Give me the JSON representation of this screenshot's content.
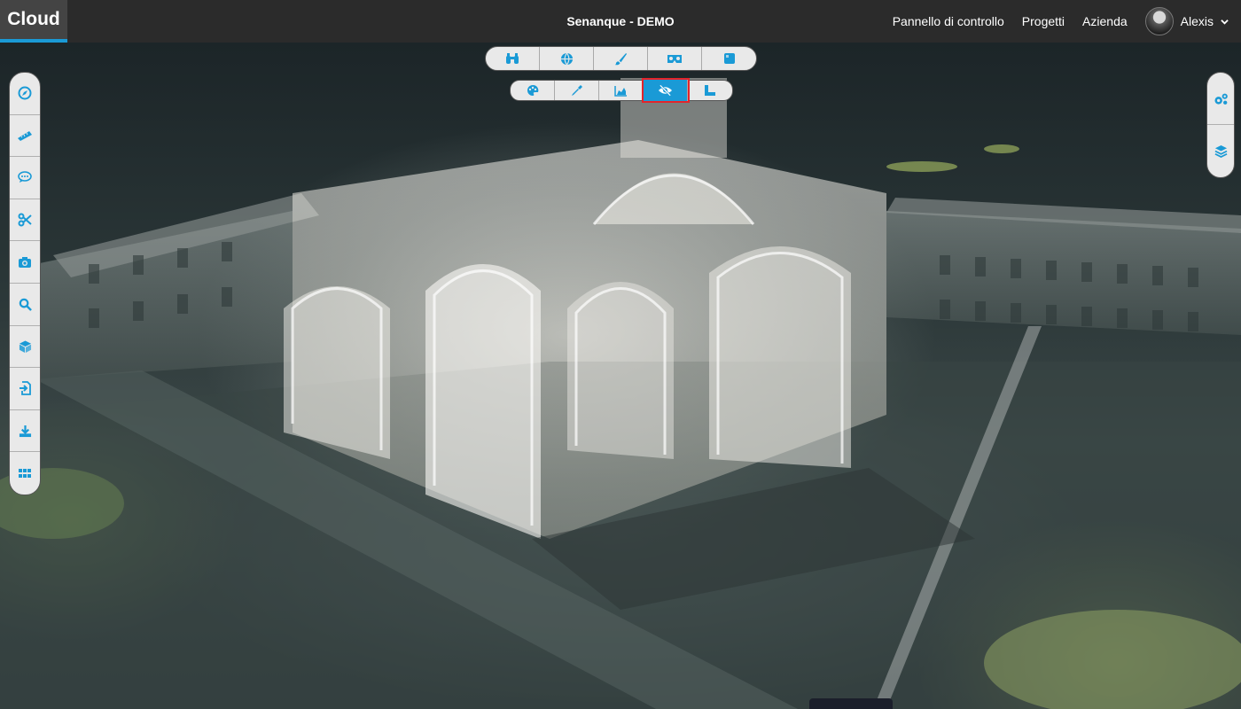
{
  "app": {
    "brand": "Cloud",
    "project_title": "Senanque - DEMO"
  },
  "nav": {
    "items": [
      {
        "label": "Pannello di controllo"
      },
      {
        "label": "Progetti"
      },
      {
        "label": "Azienda"
      }
    ],
    "user": {
      "name": "Alexis"
    }
  },
  "colors": {
    "accent": "#1a9ad6",
    "highlight": "#e3242b",
    "toolbar_bg": "#e9e9e9",
    "topbar_bg": "#2b2b2b"
  },
  "toolbar_main": {
    "buttons": [
      {
        "icon": "binoculars-icon"
      },
      {
        "icon": "globe-icon"
      },
      {
        "icon": "brush-icon"
      },
      {
        "icon": "vr-headset-icon"
      },
      {
        "icon": "square-panel-icon"
      }
    ]
  },
  "toolbar_sub": {
    "buttons": [
      {
        "icon": "palette-icon"
      },
      {
        "icon": "eyedropper-icon"
      },
      {
        "icon": "area-chart-icon"
      },
      {
        "icon": "eye-slash-icon",
        "active": true
      },
      {
        "icon": "ruler-angle-icon"
      }
    ]
  },
  "sidebar_left": {
    "buttons": [
      {
        "icon": "compass-icon"
      },
      {
        "icon": "ruler-icon"
      },
      {
        "icon": "comment-icon"
      },
      {
        "icon": "scissors-icon"
      },
      {
        "icon": "camera-icon"
      },
      {
        "icon": "search-icon"
      },
      {
        "icon": "cube-icon"
      },
      {
        "icon": "file-import-icon"
      },
      {
        "icon": "download-icon"
      },
      {
        "icon": "grid-icon"
      }
    ]
  },
  "sidebar_right": {
    "buttons": [
      {
        "icon": "settings-cogs-icon"
      },
      {
        "icon": "layers-icon"
      }
    ]
  }
}
